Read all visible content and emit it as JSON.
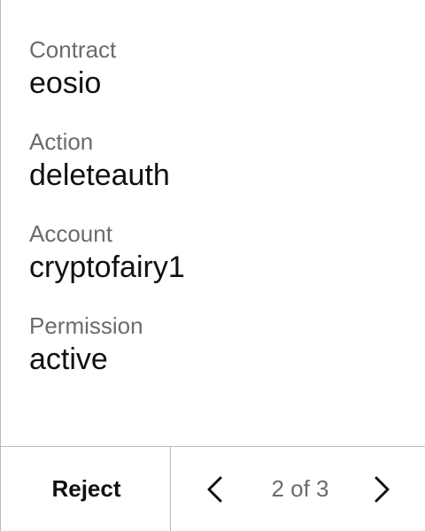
{
  "fields": [
    {
      "label": "Contract",
      "value": "eosio"
    },
    {
      "label": "Action",
      "value": "deleteauth"
    },
    {
      "label": "Account",
      "value": "cryptofairy1"
    },
    {
      "label": "Permission",
      "value": "active"
    }
  ],
  "footer": {
    "reject_label": "Reject",
    "pagination": {
      "text": "2 of 3",
      "prev_icon": "chevron-left-icon",
      "next_icon": "chevron-right-icon"
    }
  },
  "colors": {
    "label": "#6b6b6b",
    "value": "#111111",
    "divider": "#b9b9b9",
    "background": "#ffffff"
  }
}
